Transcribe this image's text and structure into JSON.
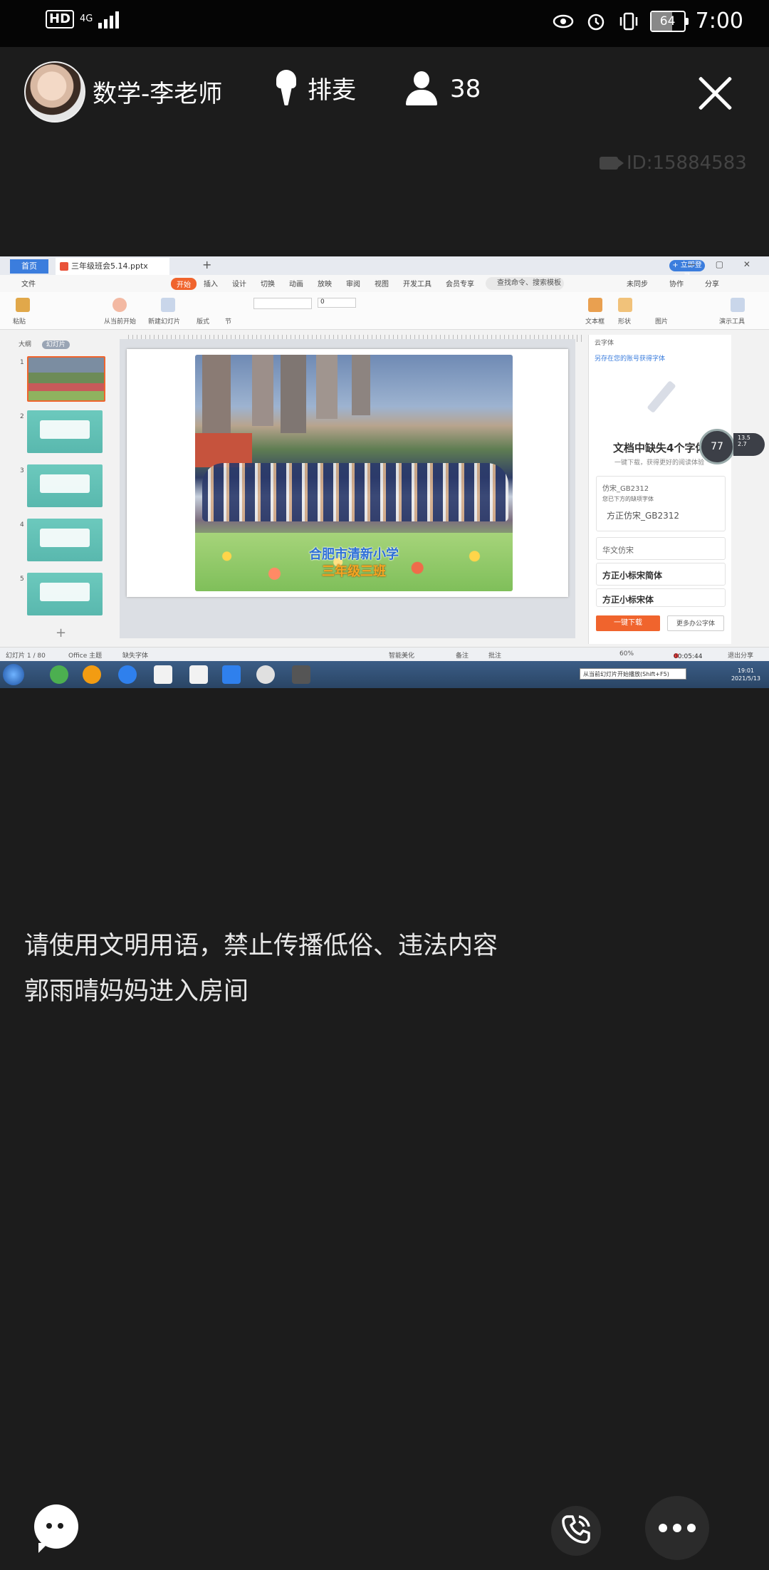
{
  "status_bar": {
    "hd": "HD",
    "network": "4G",
    "battery": "64",
    "battery_level_percent": 64,
    "time": "7:00",
    "icons": [
      "eye-icon",
      "alarm-icon",
      "vibrate-icon"
    ]
  },
  "room": {
    "teacher_name": "数学-李老师",
    "queue_label": "排麦",
    "viewer_count": "38",
    "room_id": "ID:15884583"
  },
  "shared_screen": {
    "home_tab": "首页",
    "doc_tab": "三年级班会5.14.pptx",
    "login_button": "+ 立即登录",
    "menu": [
      "文件",
      "开始",
      "插入",
      "设计",
      "切换",
      "动画",
      "放映",
      "审阅",
      "视图",
      "开发工具",
      "会员专享"
    ],
    "active_menu": "开始",
    "search_command": "查找命令、搜索模板",
    "menu_right": [
      "未同步",
      "协作",
      "分享"
    ],
    "toolbar": [
      "粘贴",
      "从当前开始",
      "新建幻灯片",
      "版式",
      "节",
      "文本框",
      "形状",
      "图片",
      "演示工具"
    ],
    "font_size": "0",
    "panel_tabs": [
      "大纲",
      "幻灯片"
    ],
    "slide_numbers": [
      "1",
      "2",
      "3",
      "4",
      "5"
    ],
    "slide_caption_line1": "合肥市清新小学",
    "slide_caption_line2": "三年级三班",
    "right_panel": {
      "header": "云字体",
      "link": "另存在您的账号获得字体",
      "title": "文档中缺失4个字体",
      "subtitle": "一键下载，获得更好的阅读体验",
      "font_label": "仿宋_GB2312",
      "font_hint": "您已下方的缺项字体",
      "font_missing": "方正仿宋_GB2312",
      "fonts": [
        "华文仿宋",
        "方正小标宋简体",
        "方正小标宋体"
      ],
      "download_button": "一键下载",
      "more_button": "更多办公字体"
    },
    "badge": "77",
    "speed_up": "13.5",
    "speed_down": "2.7",
    "status_left": "幻灯片 1 / 80",
    "theme": "Office 主题",
    "missing_font": "缺失字体",
    "smart_beautify": "智能美化",
    "notes": "备注",
    "comments": "批注",
    "zoom": "60%",
    "rec_time": "00:05:44",
    "exit_share": "退出分享",
    "tooltip": "从当前幻灯片开始播放(Shift+F5)",
    "clock_time": "19:01",
    "clock_date": "2021/5/13"
  },
  "chat": {
    "messages": [
      "请使用文明用语，禁止传播低俗、违法内容",
      "郭雨晴妈妈进入房间"
    ]
  },
  "bottom": {
    "icons": [
      "chat-icon",
      "phone-icon",
      "more-icon"
    ]
  }
}
